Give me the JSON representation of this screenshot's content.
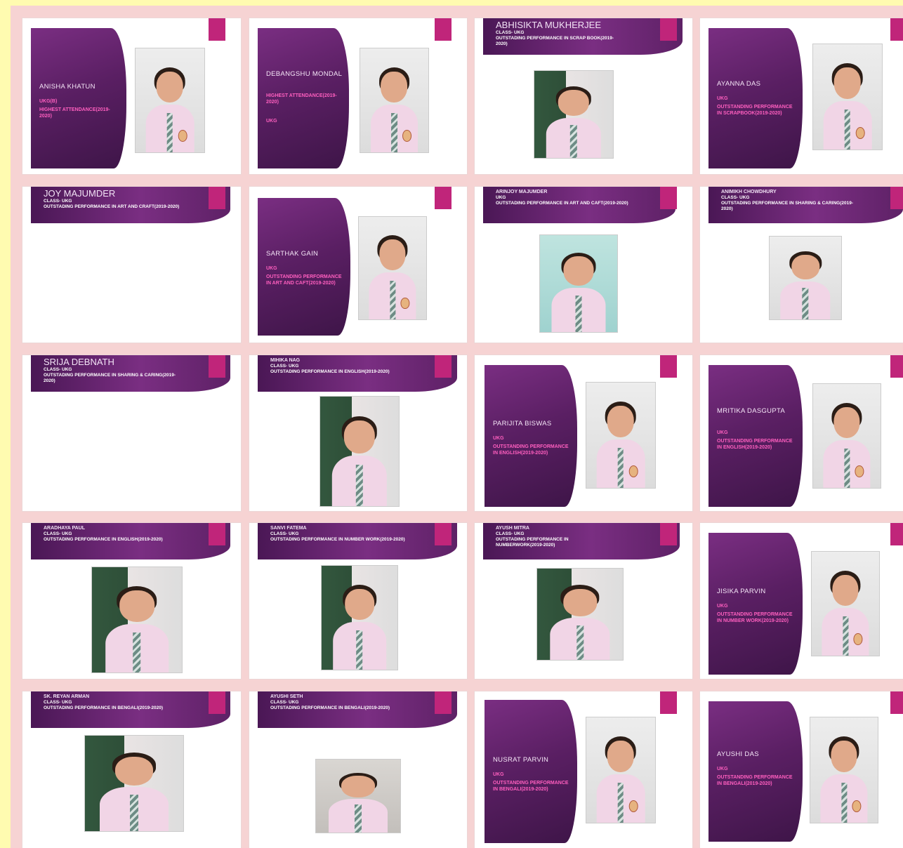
{
  "slides": [
    {
      "name": "ANISHA KHATUN",
      "l1": "UKG(B)",
      "l2": "HIGHEST ATTENDANCE(2019-2020)",
      "l3": ""
    },
    {
      "name": "DEBANGSHU MONDAL",
      "l1": "HIGHEST ATTENDANCE(2019-2020)",
      "l2": "UKG",
      "l3": ""
    },
    {
      "name": "ABHISIKTA MUKHERJEE",
      "l1": "CLASS- UKG",
      "l2": "OUTSTADING PERFORMANCE IN SCRAP BOOK(2019-2020)",
      "l3": ""
    },
    {
      "name": "AYANNA DAS",
      "l1": "UKG",
      "l2": "OUTSTANDING PERFORMANCE IN SCRAPBOOK(2019-2020)",
      "l3": ""
    },
    {
      "name": "JOY MAJUMDER",
      "l1": "CLASS- UKG",
      "l2": "OUTSTADING PERFORMANCE IN ART AND CRAFT(2019-2020)",
      "l3": ""
    },
    {
      "name": "SARTHAK GAIN",
      "l1": "UKG",
      "l2": "OUTSTANDING PERFORMANCE IN ART AND CAFT(2019-2020)",
      "l3": ""
    },
    {
      "name": "ARINJOY MAJUMDER",
      "l1": "UKG",
      "l2": "OUTSTADING PERFORMANCE IN ART AND CAFT(2019-2020)",
      "l3": ""
    },
    {
      "name": "ANIMIKH CHOWDHURY",
      "l1": "CLASS- UKG",
      "l2": "OUTSTADING PERFORMANCE IN SHARING & CARING(2019-2020)",
      "l3": ""
    },
    {
      "name": "SRIJA DEBNATH",
      "l1": "CLASS- UKG",
      "l2": "OUTSTADING PERFORMANCE IN SHARING & CARING(2019-2020)",
      "l3": ""
    },
    {
      "name": "MIHIKA NAG",
      "l1": "CLASS- UKG",
      "l2": "OUTSTADING PERFORMANCE IN ENGLISH(2019-2020)",
      "l3": ""
    },
    {
      "name": "PARIJITA BISWAS",
      "l1": "UKG",
      "l2": "OUTSTANDING PERFORMANCE IN ENGLISH(2019-2020)",
      "l3": ""
    },
    {
      "name": "MRITIKA DASGUPTA",
      "l1": "UKG",
      "l2": "OUTSTANDING PERFORMANCE IN ENGLISH(2019-2020)",
      "l3": ""
    },
    {
      "name": "ARADHAYA PAUL",
      "l1": "CLASS- UKG",
      "l2": "OUTSTADING PERFORMANCE IN ENGLISH(2019-2020)",
      "l3": ""
    },
    {
      "name": "SANVI FATEMA",
      "l1": "CLASS- UKG",
      "l2": "OUTSTADING PERFORMANCE IN NUMBER WORK(2019-2020)",
      "l3": ""
    },
    {
      "name": "AYUSH MITRA",
      "l1": "CLASS- UKG",
      "l2": "OUTSTADING PERFORMANCE IN NUMBERWORK(2019-2020)",
      "l3": ""
    },
    {
      "name": "JISIKA PARVIN",
      "l1": "UKG",
      "l2": "OUTSTANDING PERFORMANCE IN NUMBER WORK(2019-2020)",
      "l3": ""
    },
    {
      "name": "SK. REYAN ARMAN",
      "l1": "CLASS- UKG",
      "l2": "OUTSTADING PERFORMANCE IN BENGALI(2019-2020)",
      "l3": ""
    },
    {
      "name": "AYUSHI SETH",
      "l1": "CLASS- UKG",
      "l2": "OUTSTADING PERFORMANCE IN BENGALI(2019-2020)",
      "l3": ""
    },
    {
      "name": "NUSRAT PARVIN",
      "l1": "UKG",
      "l2": "OUTSTANDING PERFORMANCE IN BENGALI(2019-2020)",
      "l3": ""
    },
    {
      "name": "AYUSHI DAS",
      "l1": "UKG",
      "l2": "OUTSTANDING PERFORMANCE IN BENGALI(2019-2020)",
      "l3": ""
    }
  ],
  "colors": {
    "background": "#fffbb0",
    "grid": "#f6d3d3",
    "accent": "#c0257a",
    "band": "#5a1f63",
    "pink_text": "#ff5fbf"
  }
}
